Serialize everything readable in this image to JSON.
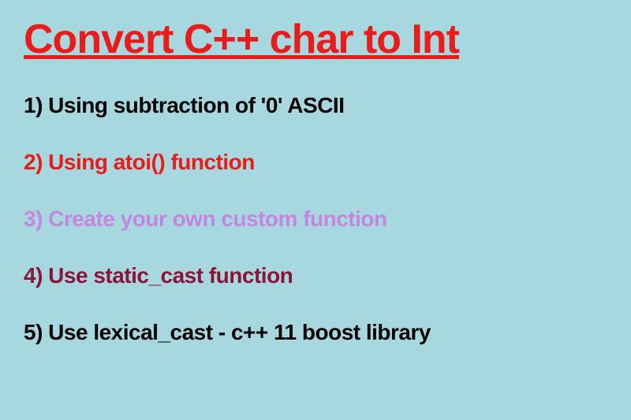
{
  "title": "Convert C++ char to Int",
  "items": [
    {
      "text": "1) Using subtraction of '0' ASCII",
      "colorClass": "item-1"
    },
    {
      "text": "2) Using atoi() function",
      "colorClass": "item-2"
    },
    {
      "text": "3) Create your own custom function",
      "colorClass": "item-3"
    },
    {
      "text": "4) Use static_cast function",
      "colorClass": "item-4"
    },
    {
      "text": "5) Use lexical_cast - c++ 11 boost library",
      "colorClass": "item-5"
    }
  ]
}
